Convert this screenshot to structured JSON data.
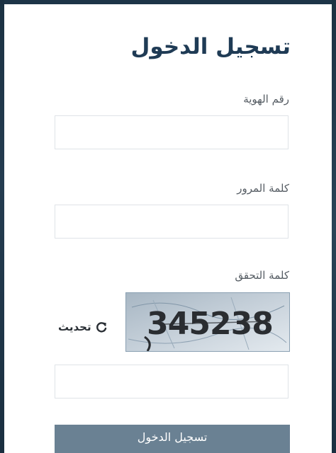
{
  "form": {
    "title": "تسجيل الدخول",
    "id_label": "رقم الهوية",
    "id_value": "",
    "password_label": "كلمة المرور",
    "password_value": "",
    "captcha_label": "كلمة التحقق",
    "captcha_text": "345238",
    "refresh_label": "تحديث",
    "refresh_icon": "refresh-icon",
    "captcha_input_value": "",
    "submit_label": "تسجيل الدخول"
  },
  "colors": {
    "title": "#1f3b55",
    "submit_bg": "#6a8193",
    "frame": "#1d3447"
  }
}
